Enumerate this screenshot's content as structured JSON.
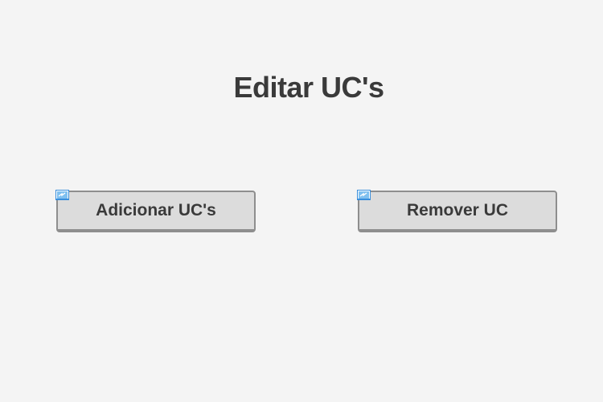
{
  "page": {
    "title": "Editar UC's"
  },
  "buttons": [
    {
      "label": "Adicionar UC's",
      "icon": "link-icon"
    },
    {
      "label": "Remover UC",
      "icon": "link-icon"
    }
  ],
  "colors": {
    "background": "#f4f4f4",
    "button_fill": "#dcdcdc",
    "button_border": "#8e8e8e",
    "text": "#3a3a3a",
    "icon_accent": "#3a8fdc"
  }
}
